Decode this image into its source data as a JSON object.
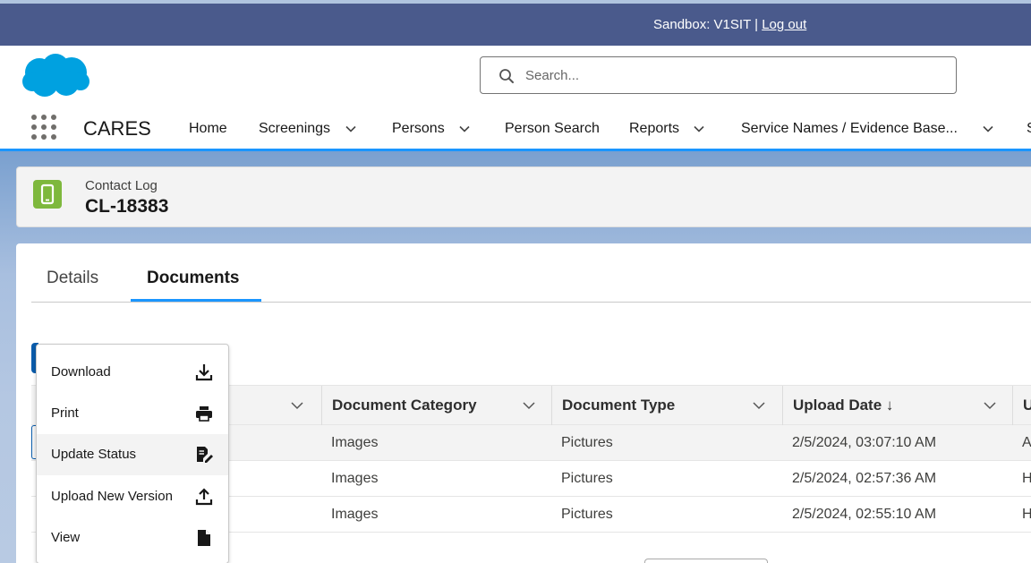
{
  "sandbox": {
    "label": "Sandbox: V1SIT | ",
    "logout": "Log out"
  },
  "search": {
    "placeholder": "Search..."
  },
  "app": {
    "name": "CARES"
  },
  "nav": {
    "home": "Home",
    "screenings": "Screenings",
    "persons": "Persons",
    "person_search": "Person Search",
    "reports": "Reports",
    "service_names": "Service Names / Evidence Base...",
    "next": "S"
  },
  "record": {
    "type": "Contact Log",
    "id": "CL-18383"
  },
  "tabs": {
    "details": "Details",
    "documents": "Documents"
  },
  "table": {
    "headers": {
      "category": "Document Category",
      "type": "Document Type",
      "upload": "Upload Date ↓",
      "next": "U"
    },
    "rows": [
      {
        "category": "Images",
        "type": "Pictures",
        "date": "2/5/2024, 03:07:10 AM",
        "next": "A"
      },
      {
        "category": "Images",
        "type": "Pictures",
        "date": "2/5/2024, 02:57:36 AM",
        "next": "H"
      },
      {
        "category": "Images",
        "type": "Pictures",
        "date": "2/5/2024, 02:55:10 AM",
        "next": "H"
      }
    ]
  },
  "menu": {
    "download": "Download",
    "print": "Print",
    "update_status": "Update Status",
    "upload_new_version": "Upload New Version",
    "view": "View"
  },
  "icons": {
    "logo": "salesforce-cloud-icon",
    "search": "search-icon",
    "apps": "app-launcher-icon",
    "record": "tablet-icon",
    "download": "download-icon",
    "print": "print-icon",
    "update_status": "edit-document-icon",
    "upload": "upload-icon",
    "view": "document-icon"
  },
  "colors": {
    "brand": "#1b96ff",
    "sandbox_bar": "#4a5a8c",
    "record_icon": "#7eb83d",
    "primary_button": "#0b5cab"
  }
}
